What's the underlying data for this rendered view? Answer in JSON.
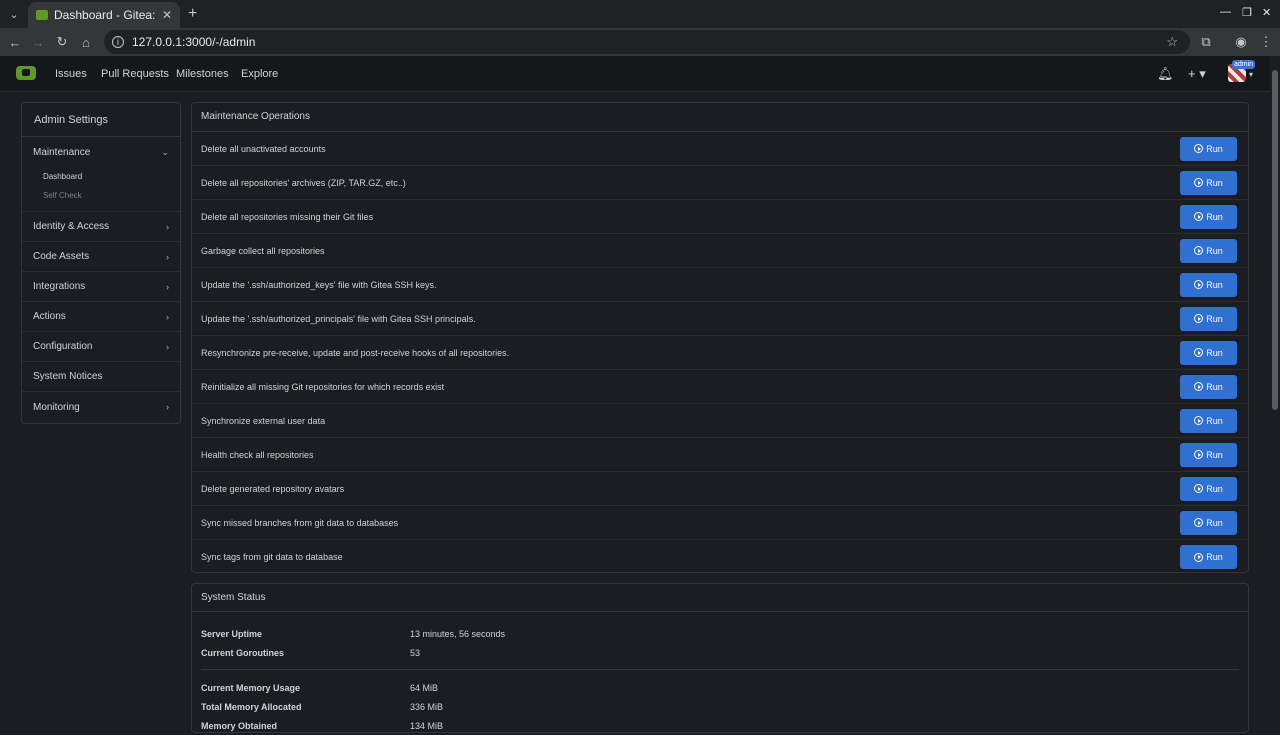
{
  "browser": {
    "tab_title": "Dashboard - Gitea: Git v",
    "url": "127.0.0.1:3000/-/admin"
  },
  "navbar": {
    "items": [
      "Issues",
      "Pull Requests",
      "Milestones",
      "Explore"
    ],
    "admin_badge": "admin"
  },
  "sidebar": {
    "title": "Admin Settings",
    "maintenance": {
      "label": "Maintenance",
      "children": [
        "Dashboard",
        "Self Check"
      ]
    },
    "sections": [
      "Identity & Access",
      "Code Assets",
      "Integrations",
      "Actions",
      "Configuration",
      "System Notices",
      "Monitoring"
    ]
  },
  "maintenance": {
    "title": "Maintenance Operations",
    "run_label": "Run",
    "operations": [
      "Delete all unactivated accounts",
      "Delete all repositories' archives (ZIP, TAR.GZ, etc..)",
      "Delete all repositories missing their Git files",
      "Garbage collect all repositories",
      "Update the '.ssh/authorized_keys' file with Gitea SSH keys.",
      "Update the '.ssh/authorized_principals' file with Gitea SSH principals.",
      "Resynchronize pre-receive, update and post-receive hooks of all repositories.",
      "Reinitialize all missing Git repositories for which records exist",
      "Synchronize external user data",
      "Health check all repositories",
      "Delete generated repository avatars",
      "Sync missed branches from git data to databases",
      "Sync tags from git data to database"
    ]
  },
  "system_status": {
    "title": "System Status",
    "group1": [
      {
        "key": "Server Uptime",
        "value": "13 minutes, 56 seconds"
      },
      {
        "key": "Current Goroutines",
        "value": "53"
      }
    ],
    "group2": [
      {
        "key": "Current Memory Usage",
        "value": "64 MiB"
      },
      {
        "key": "Total Memory Allocated",
        "value": "336 MiB"
      },
      {
        "key": "Memory Obtained",
        "value": "134 MiB"
      }
    ]
  },
  "colors": {
    "accent": "#2f70d0",
    "logo": "#609926",
    "background": "#1c1d22"
  }
}
